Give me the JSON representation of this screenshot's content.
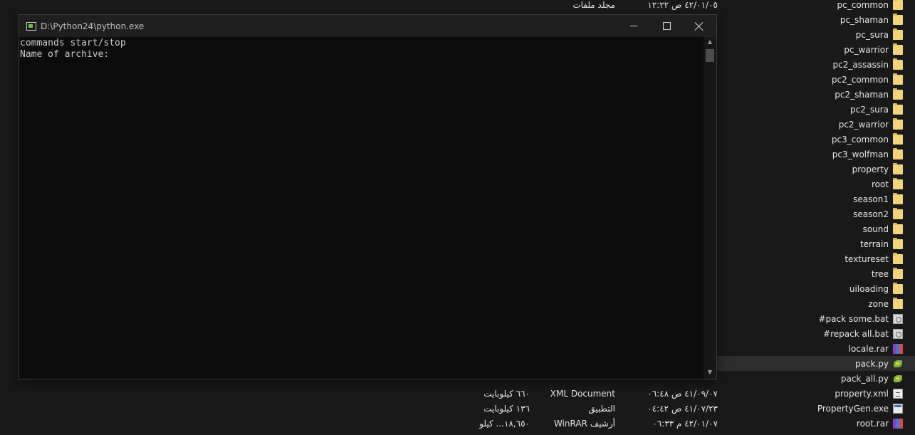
{
  "console": {
    "title": "D:\\Python24\\python.exe",
    "lines": [
      "commands start/stop",
      "Name of archive:"
    ]
  },
  "explorer": {
    "files": [
      {
        "name": "pc_common",
        "icon": "folder-icon"
      },
      {
        "name": "pc_shaman",
        "icon": "folder-icon"
      },
      {
        "name": "pc_sura",
        "icon": "folder-icon"
      },
      {
        "name": "pc_warrior",
        "icon": "folder-icon"
      },
      {
        "name": "pc2_assassin",
        "icon": "folder-icon"
      },
      {
        "name": "pc2_common",
        "icon": "folder-icon"
      },
      {
        "name": "pc2_shaman",
        "icon": "folder-icon"
      },
      {
        "name": "pc2_sura",
        "icon": "folder-icon"
      },
      {
        "name": "pc2_warrior",
        "icon": "folder-icon"
      },
      {
        "name": "pc3_common",
        "icon": "folder-icon"
      },
      {
        "name": "pc3_wolfman",
        "icon": "folder-icon"
      },
      {
        "name": "property",
        "icon": "folder-icon"
      },
      {
        "name": "root",
        "icon": "folder-icon"
      },
      {
        "name": "season1",
        "icon": "folder-icon"
      },
      {
        "name": "season2",
        "icon": "folder-icon"
      },
      {
        "name": "sound",
        "icon": "folder-icon"
      },
      {
        "name": "terrain",
        "icon": "folder-icon"
      },
      {
        "name": "textureset",
        "icon": "folder-icon"
      },
      {
        "name": "tree",
        "icon": "folder-icon"
      },
      {
        "name": "uiloading",
        "icon": "folder-icon"
      },
      {
        "name": "zone",
        "icon": "folder-icon"
      },
      {
        "name": "#pack some.bat",
        "icon": "bat-icon"
      },
      {
        "name": "#repack all.bat",
        "icon": "bat-icon"
      },
      {
        "name": "locale.rar",
        "icon": "rar-icon"
      },
      {
        "name": "pack.py",
        "icon": "python-icon",
        "selected": true
      },
      {
        "name": "pack_all.py",
        "icon": "python-icon"
      },
      {
        "name": "property.xml",
        "icon": "xml-icon"
      },
      {
        "name": "PropertyGen.exe",
        "icon": "exe-icon"
      },
      {
        "name": "root.rar",
        "icon": "rar-icon"
      }
    ],
    "details": [
      {
        "date": "٤٢/٠١/٠٥ ص ١٢:٢٢",
        "type": "مجلد ملفات",
        "size": ""
      },
      {
        "date": "٤١/٠٩/٠٧ ص ٠٦:٤٨",
        "type": "XML Document",
        "size": "٦٦٠ كيلوبايت"
      },
      {
        "date": "٤١/٠٧/٢٣ ص ٠٤:٤٢",
        "type": "التطبيق",
        "size": "١٣٦ كيلوبايت"
      },
      {
        "date": "٤٢/٠١/٠٧ م ٠٦:٣٣",
        "type": "أرشيف WinRAR",
        "size": "١٨,٦٥٠... كيلو"
      }
    ]
  }
}
